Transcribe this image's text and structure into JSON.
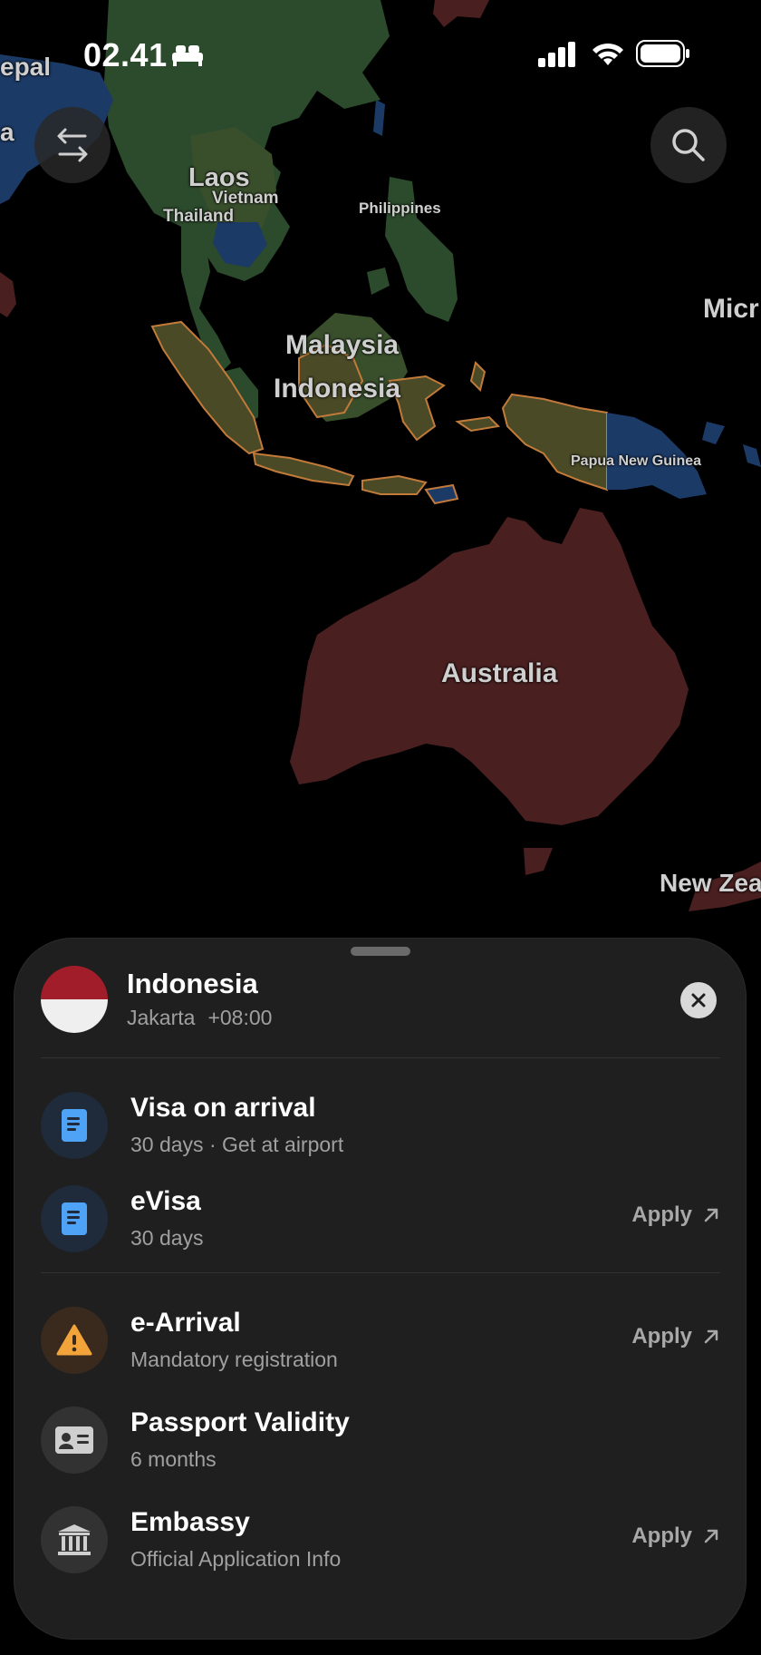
{
  "status_bar": {
    "time": "02.41"
  },
  "map": {
    "labels": {
      "nepal": "epal",
      "india_fragment": "a",
      "laos": "Laos",
      "vietnam": "Vietnam",
      "thailand": "Thailand",
      "philippines": "Philippines",
      "micronesia": "Micr",
      "malaysia": "Malaysia",
      "indonesia": "Indonesia",
      "png": "Papua New Guinea",
      "australia": "Australia",
      "new_zealand": "New Zea"
    }
  },
  "sheet": {
    "country": "Indonesia",
    "capital": "Jakarta",
    "timezone": "+08:00",
    "items": [
      {
        "title": "Visa on arrival",
        "subtitle": "30 days · Get at airport",
        "icon": "document-icon"
      },
      {
        "title": "eVisa",
        "subtitle": "30 days",
        "action": "Apply",
        "icon": "document-icon"
      },
      {
        "title": "e-Arrival",
        "subtitle": "Mandatory registration",
        "action": "Apply",
        "icon": "warning-icon"
      },
      {
        "title": "Passport Validity",
        "subtitle": "6 months",
        "icon": "id-card-icon"
      },
      {
        "title": "Embassy",
        "subtitle": "Official Application Info",
        "action": "Apply",
        "icon": "bank-icon"
      }
    ]
  },
  "colors": {
    "visa_free_green": "#2c4a2c",
    "visa_on_arrival_olive": "#4a4a27",
    "visa_blue": "#1c3a66",
    "restricted_red": "#4a1f20",
    "country_border_orange": "#c17a3a",
    "info_blue": "#4fa3f7",
    "warning_orange": "#f2a33a"
  }
}
